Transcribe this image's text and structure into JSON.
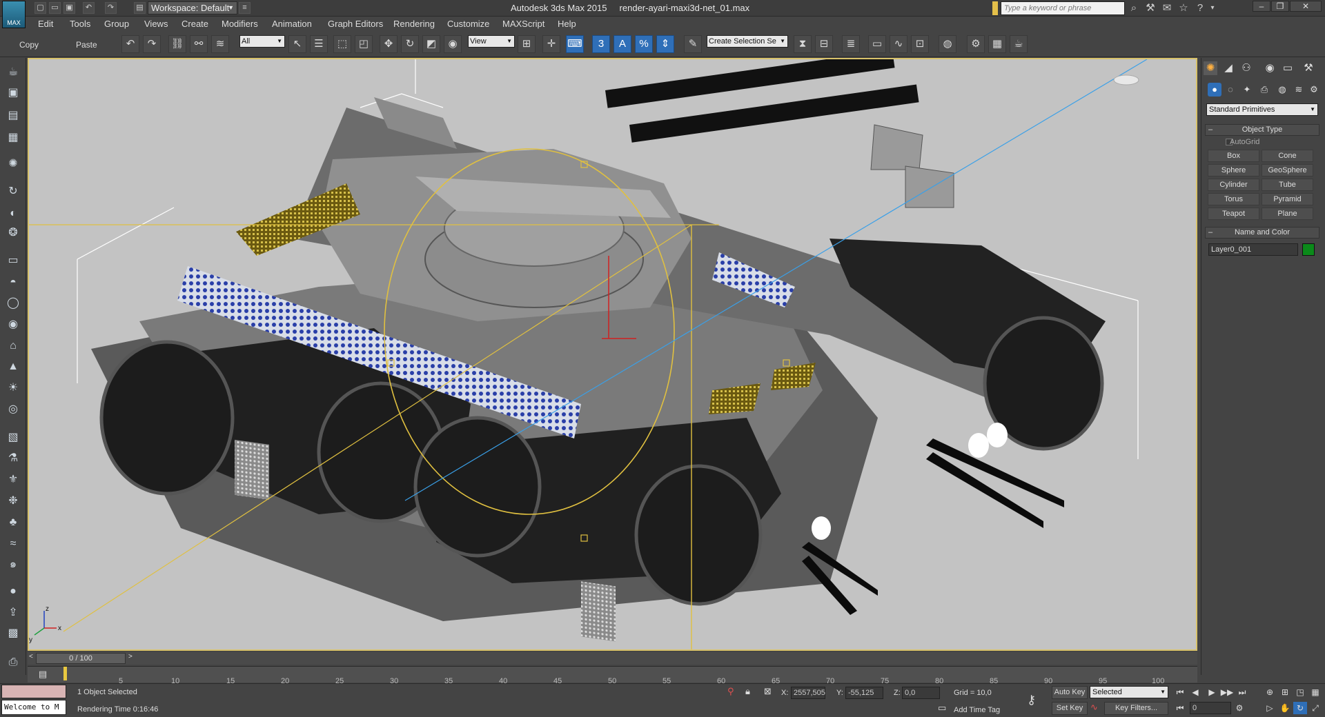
{
  "app": {
    "logo_label": "MAX",
    "title": "Autodesk 3ds Max  2015",
    "filename": "render-ayari-maxi3d-net_01.max",
    "workspace_label": "Workspace: Default",
    "search_placeholder": "Type a keyword or phrase"
  },
  "menu": [
    "Edit",
    "Tools",
    "Group",
    "Views",
    "Create",
    "Modifiers",
    "Animation",
    "Graph Editors",
    "Rendering",
    "Customize",
    "MAXScript",
    "Help"
  ],
  "toolbar": {
    "copy_label": "Copy",
    "paste_label": "Paste",
    "selection_filter": "All",
    "ref_coord": "View",
    "named_selection": "Create Selection Se",
    "snap_value": "3",
    "angle_snap_value": "A",
    "percent_snap_value": "%"
  },
  "command_panel": {
    "primitive_type": "Standard Primitives",
    "object_type_header": "Object Type",
    "autogrid_label": "AutoGrid",
    "buttons": [
      "Box",
      "Cone",
      "Sphere",
      "GeoSphere",
      "Cylinder",
      "Tube",
      "Torus",
      "Pyramid",
      "Teapot",
      "Plane"
    ],
    "name_color_header": "Name and Color",
    "object_name": "Layer0_001",
    "object_color": "#0b8a1a"
  },
  "viewport": {
    "axis_labels": [
      "z",
      "y",
      "x"
    ]
  },
  "timeline": {
    "frame_display": "0 / 100",
    "ticks": [
      "5",
      "10",
      "15",
      "20",
      "25",
      "30",
      "35",
      "40",
      "45",
      "50",
      "55",
      "60",
      "65",
      "70",
      "75",
      "80",
      "85",
      "90",
      "95",
      "100"
    ]
  },
  "status": {
    "welcome": "Welcome to M",
    "selection": "1 Object Selected",
    "render_time": "Rendering Time  0:16:46",
    "x_label": "X:",
    "x_value": "2557,505",
    "y_label": "Y:",
    "y_value": "-55,125",
    "z_label": "Z:",
    "z_value": "0,0",
    "grid": "Grid = 10,0",
    "add_time_tag": "Add Time Tag",
    "auto_key": "Auto Key",
    "set_key": "Set Key",
    "key_mode": "Selected",
    "key_filters": "Key Filters...",
    "current_frame": "0"
  }
}
